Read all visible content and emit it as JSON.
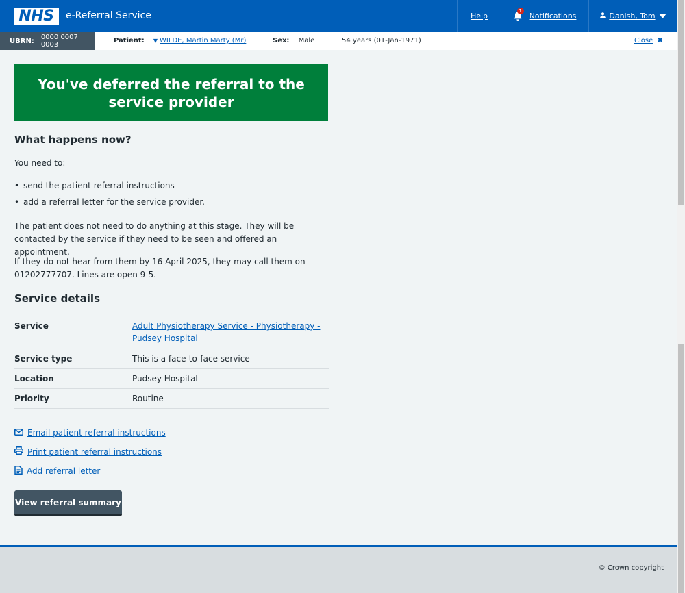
{
  "header": {
    "logo": "NHS",
    "service_name": "e-Referral Service",
    "help": "Help",
    "notifications": "Notifications",
    "notification_count": "1",
    "user": "Danish, Tom"
  },
  "banner": {
    "ubrn_label": "UBRN:",
    "ubrn_value": "0000 0007 0003",
    "patient_label": "Patient:",
    "patient_name": "WILDE, Martin Marty (Mr)",
    "sex_label": "Sex:",
    "sex_value": "Male",
    "age": "54 years (01-Jan-1971)",
    "close": "Close"
  },
  "confirmation": {
    "title": "You've deferred the referral to the service provider"
  },
  "what_next": {
    "heading": "What happens now?",
    "intro": "You need to:",
    "items": [
      "send the patient referral instructions",
      "add a referral letter for the service provider."
    ],
    "para1": "The patient does not need to do anything at this stage. They will be contacted by the service if they need to be seen and offered an appointment.",
    "para2": "If they do not hear from them by 16 April 2025, they may call them on 01202777707. Lines are open 9-5."
  },
  "service_details": {
    "heading": "Service details",
    "rows": [
      {
        "key": "Service",
        "value": "Adult Physiotherapy Service - Physiotherapy - Pudsey Hospital"
      },
      {
        "key": "Service type",
        "value": "This is a face-to-face service"
      },
      {
        "key": "Location",
        "value": "Pudsey Hospital"
      },
      {
        "key": "Priority",
        "value": "Routine"
      }
    ]
  },
  "actions": {
    "email": "Email patient referral instructions",
    "print": "Print patient referral instructions",
    "letter": "Add referral letter"
  },
  "button": {
    "view_summary": "View referral summary"
  },
  "footer": {
    "copyright": "© Crown copyright"
  },
  "colors": {
    "nhs_blue": "#005eb8",
    "success_green": "#007f3b",
    "secondary_button": "#425563"
  }
}
